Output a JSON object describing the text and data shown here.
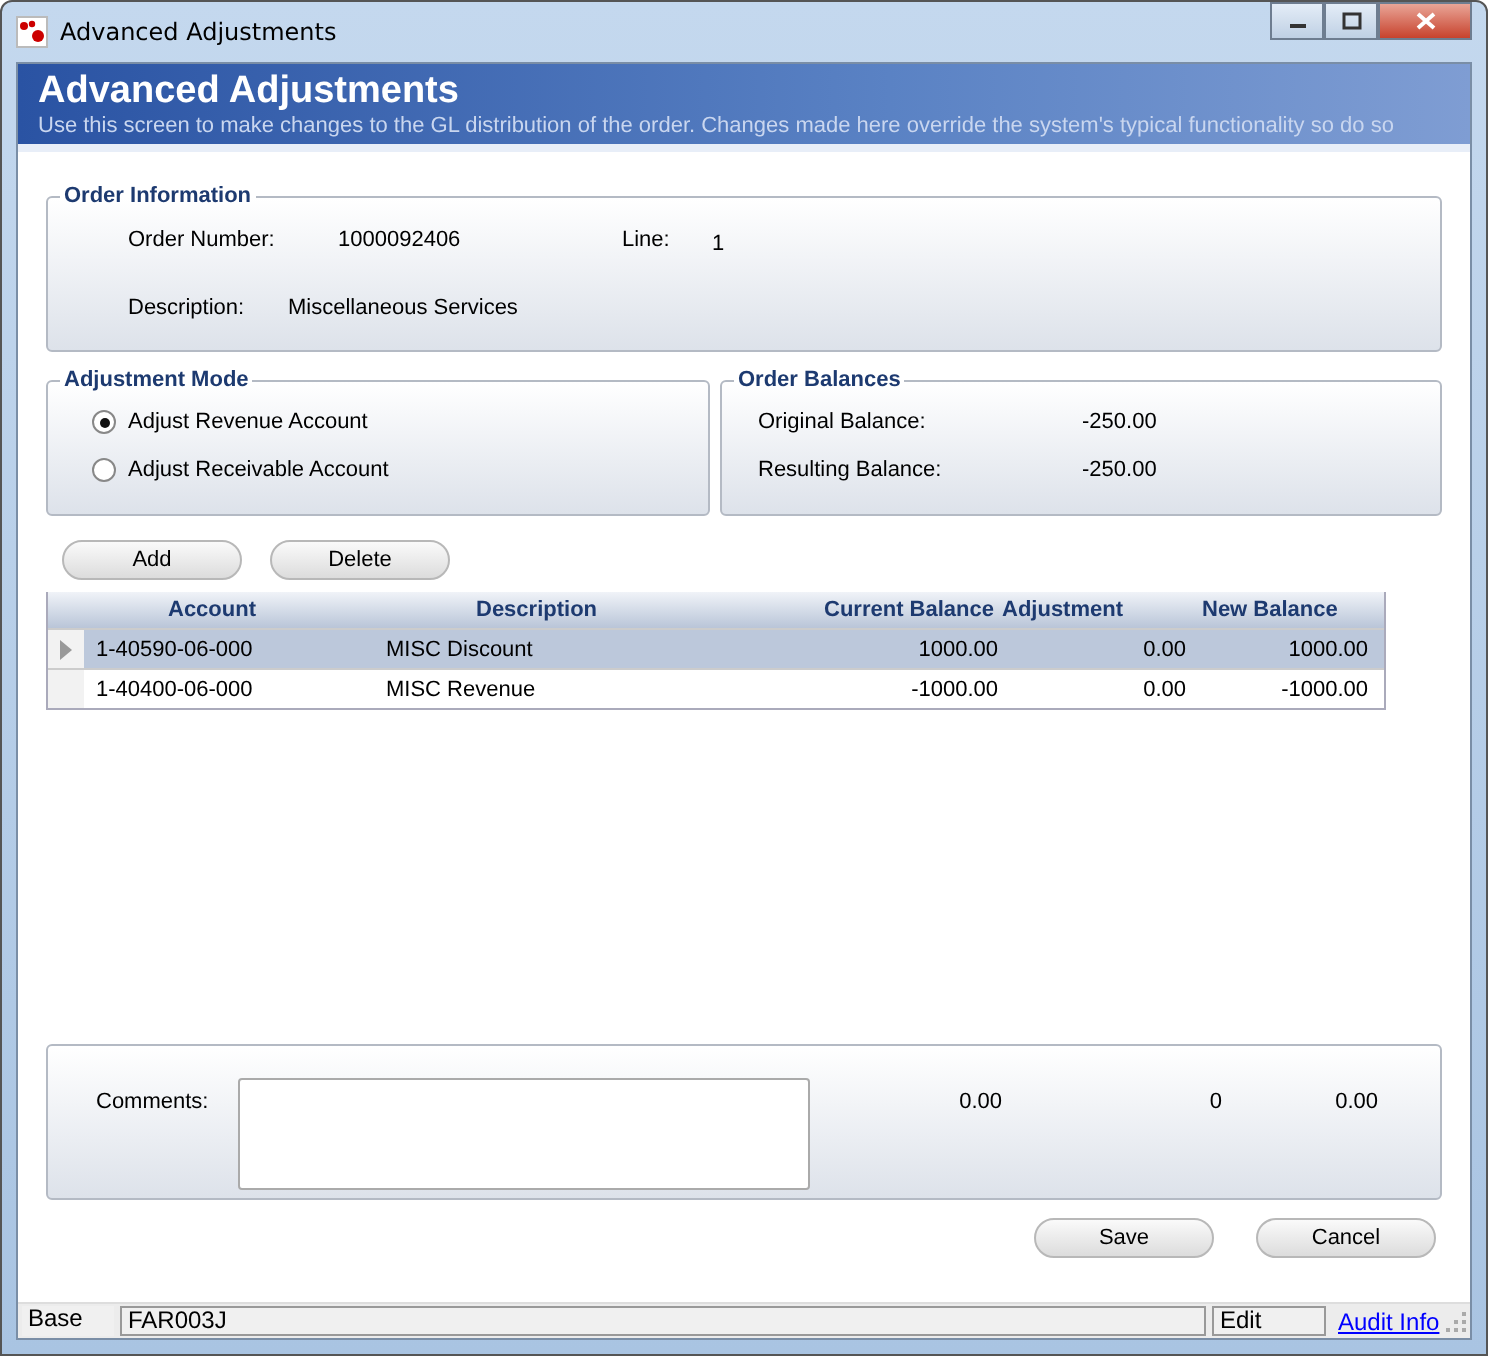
{
  "window": {
    "title": "Advanced Adjustments"
  },
  "header": {
    "title": "Advanced Adjustments",
    "subtitle": "Use this screen to make changes to the GL distribution of the order. Changes made here override the system's typical functionality so do so"
  },
  "order_information": {
    "legend": "Order Information",
    "fields": [
      {
        "label": "Order Number:",
        "value": "1000092406"
      },
      {
        "label": "Line:",
        "value": "1"
      },
      {
        "label": "Description:",
        "value": "Miscellaneous Services"
      }
    ]
  },
  "adjustment_mode": {
    "legend": "Adjustment Mode",
    "options": [
      {
        "label": "Adjust Revenue Account",
        "selected": true
      },
      {
        "label": "Adjust Receivable Account",
        "selected": false
      }
    ]
  },
  "order_balances": {
    "legend": "Order Balances",
    "fields": [
      {
        "label": "Original Balance:",
        "value": "-250.00"
      },
      {
        "label": "Resulting Balance:",
        "value": "-250.00"
      }
    ]
  },
  "grid_buttons": [
    "Add",
    "Delete"
  ],
  "table": {
    "columns": [
      "Account",
      "Description",
      "Current Balance",
      "Adjustment",
      "New Balance"
    ],
    "rows": [
      {
        "selected": true,
        "cells": [
          "1-40590-06-000",
          "MISC Discount",
          "1000.00",
          "0.00",
          "1000.00"
        ]
      },
      {
        "selected": false,
        "cells": [
          "1-40400-06-000",
          "MISC Revenue",
          "-1000.00",
          "0.00",
          "-1000.00"
        ]
      }
    ]
  },
  "totals": {
    "comments_label": "Comments:",
    "values": [
      "0.00",
      "0",
      "0.00"
    ]
  },
  "buttons": [
    "Save",
    "Cancel"
  ],
  "status_bar": {
    "mode": "Base",
    "form": "FAR003J",
    "state": "Edit",
    "link": "Audit Info"
  }
}
